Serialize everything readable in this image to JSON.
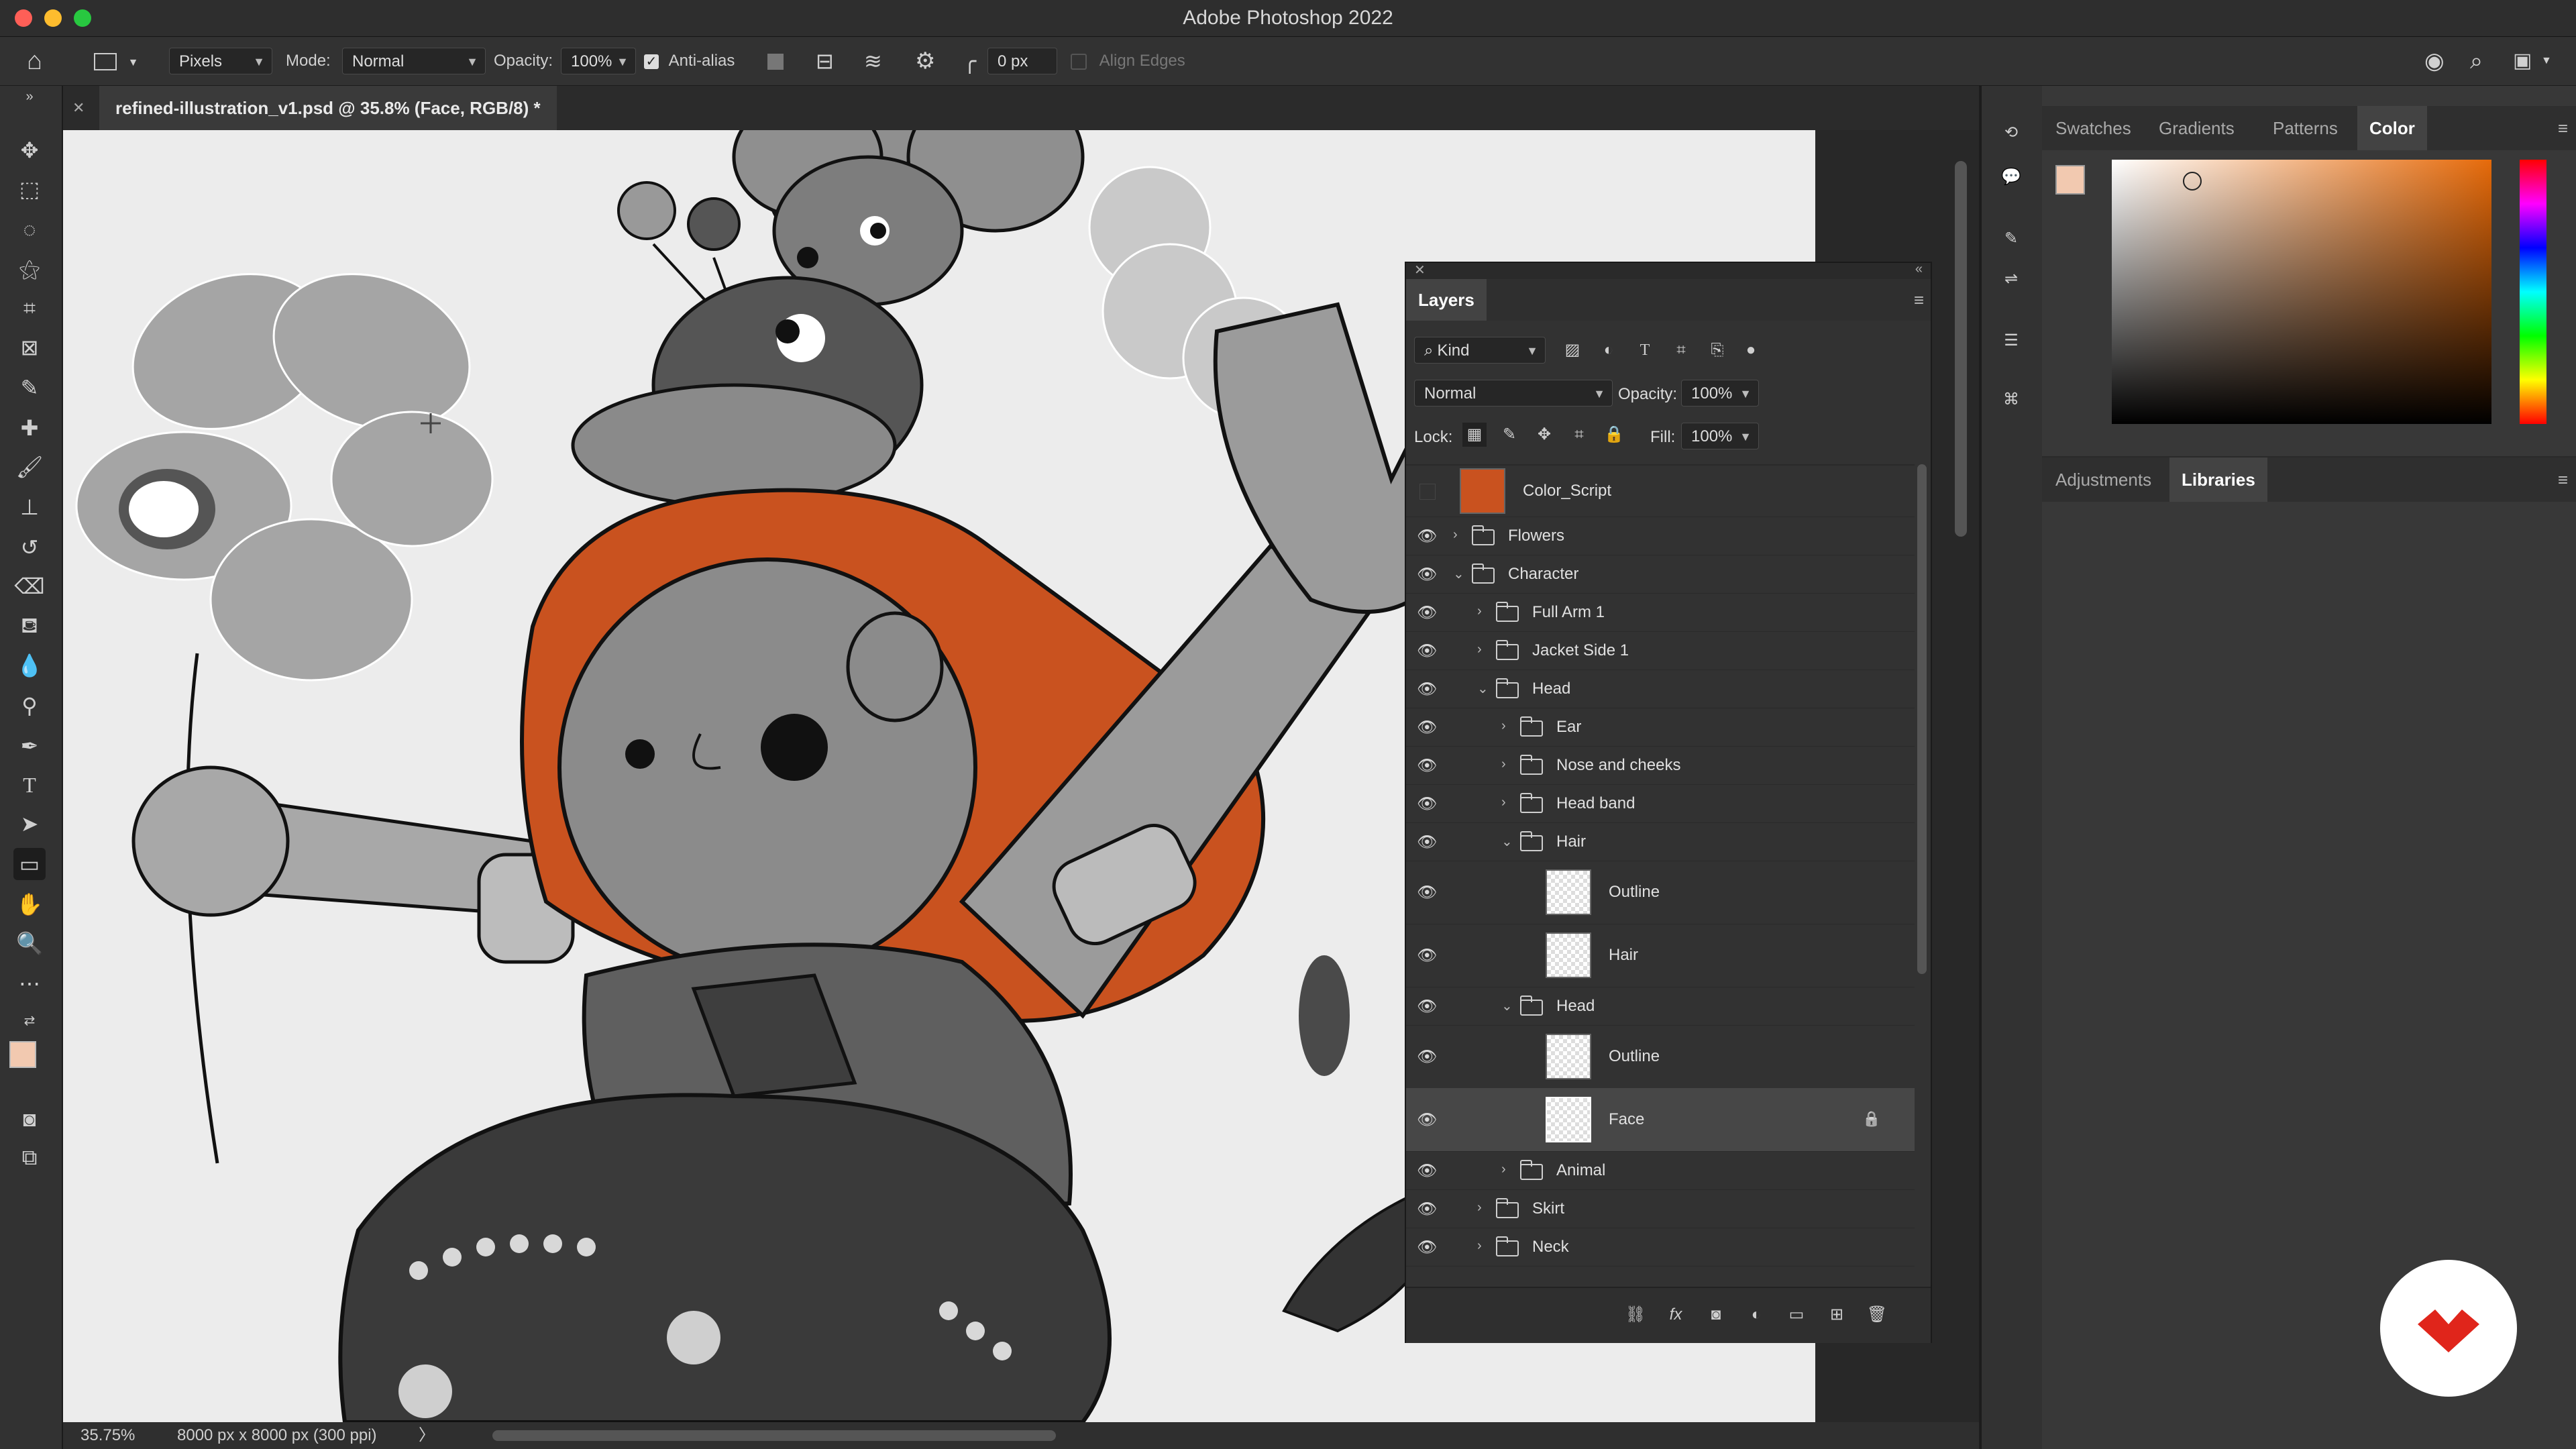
{
  "window": {
    "title": "Adobe Photoshop 2022"
  },
  "options_bar": {
    "units_select": "Pixels",
    "mode_label": "Mode:",
    "mode_value": "Normal",
    "opacity_label": "Opacity:",
    "opacity_value": "100%",
    "anti_alias_label": "Anti-alias",
    "anti_alias_checked": true,
    "radius_value": "0 px",
    "align_edges_label": "Align Edges"
  },
  "document": {
    "tab_title": "refined-illustration_v1.psd @ 35.8% (Face, RGB/8) *"
  },
  "status_bar": {
    "zoom": "35.75%",
    "doc_info": "8000 px x 8000 px (300 ppi)",
    "arrow": "〉"
  },
  "right_panel": {
    "tabs": [
      "Swatches",
      "Gradients",
      "Patterns",
      "Color"
    ],
    "active_tab": "Color",
    "foreground_color": "#f2c9b0",
    "lower_tabs": [
      "Adjustments",
      "Libraries"
    ],
    "lower_active_tab": "Libraries"
  },
  "layers_panel": {
    "title": "Layers",
    "filter_kind": "Kind",
    "blend_mode": "Normal",
    "opacity_label": "Opacity:",
    "opacity_value": "100%",
    "lock_label": "Lock:",
    "fill_label": "Fill:",
    "fill_value": "100%",
    "layers": [
      {
        "name": "Color_Script",
        "type": "smart",
        "visible": false,
        "expanded": false
      },
      {
        "name": "Flowers",
        "type": "group",
        "visible": true,
        "expanded": false
      },
      {
        "name": "Character",
        "type": "group",
        "visible": true,
        "expanded": true
      },
      {
        "name": "Full Arm 1",
        "type": "group",
        "visible": true,
        "expanded": false
      },
      {
        "name": "Jacket Side 1",
        "type": "group",
        "visible": true,
        "expanded": false
      },
      {
        "name": "Head",
        "type": "group",
        "visible": true,
        "expanded": true
      },
      {
        "name": "Ear",
        "type": "group",
        "visible": true,
        "expanded": false
      },
      {
        "name": "Nose and cheeks",
        "type": "group",
        "visible": true,
        "expanded": false
      },
      {
        "name": "Head band",
        "type": "group",
        "visible": true,
        "expanded": false
      },
      {
        "name": "Hair",
        "type": "group",
        "visible": true,
        "expanded": true
      },
      {
        "name": "Outline",
        "type": "layer",
        "visible": true
      },
      {
        "name": "Hair",
        "type": "layer",
        "visible": true
      },
      {
        "name": "Head",
        "type": "group",
        "visible": true,
        "expanded": true
      },
      {
        "name": "Outline",
        "type": "layer",
        "visible": true
      },
      {
        "name": "Face",
        "type": "layer",
        "visible": true,
        "selected": true,
        "locked": true
      },
      {
        "name": "Animal",
        "type": "group",
        "visible": true,
        "expanded": false
      },
      {
        "name": "Skirt",
        "type": "group",
        "visible": true,
        "expanded": false
      },
      {
        "name": "Neck",
        "type": "group",
        "visible": true,
        "expanded": false
      }
    ]
  },
  "colors": {
    "hair_orange": "#c9521f",
    "accent_red": "#e0251b"
  }
}
